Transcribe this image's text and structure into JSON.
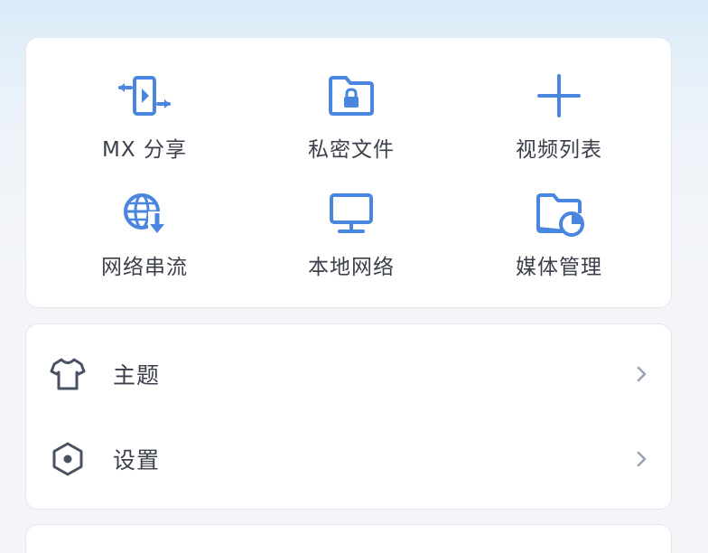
{
  "colors": {
    "accent": "#4a86e0",
    "text": "#3b3f4a",
    "row_icon": "#4a5162",
    "chevron": "#9aa3b5",
    "card_bg": "#ffffff"
  },
  "grid": {
    "items": [
      {
        "label": "MX 分享",
        "icon": "share-transfer-icon"
      },
      {
        "label": "私密文件",
        "icon": "locked-folder-icon"
      },
      {
        "label": "视频列表",
        "icon": "plus-icon"
      },
      {
        "label": "网络串流",
        "icon": "globe-download-icon"
      },
      {
        "label": "本地网络",
        "icon": "monitor-icon"
      },
      {
        "label": "媒体管理",
        "icon": "folder-chart-icon"
      }
    ]
  },
  "list": {
    "items": [
      {
        "label": "主题",
        "icon": "tshirt-icon"
      },
      {
        "label": "设置",
        "icon": "hexagon-settings-icon"
      }
    ]
  }
}
